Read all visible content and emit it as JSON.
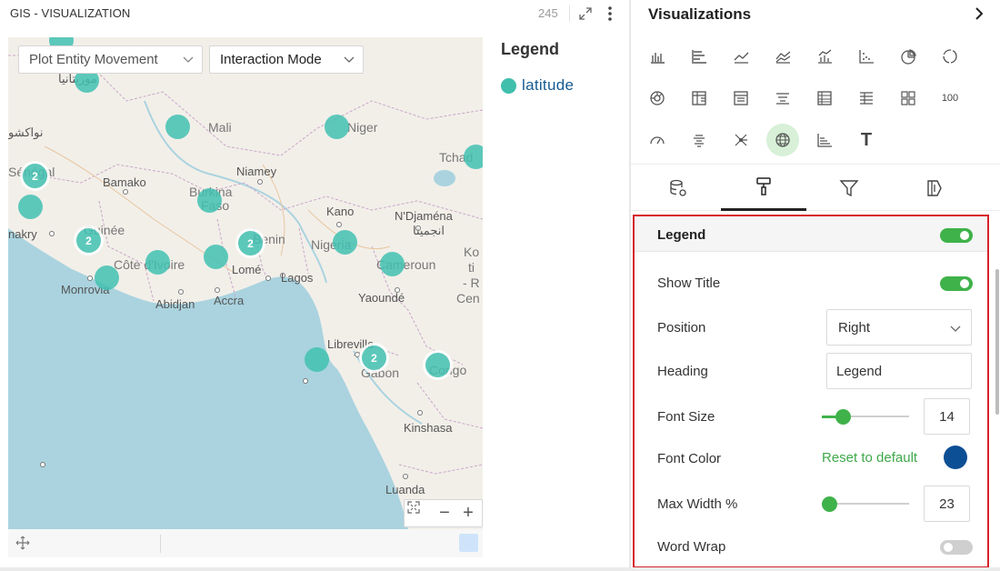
{
  "left_panel": {
    "title": "GIS - VISUALIZATION",
    "count": "245"
  },
  "map": {
    "dropdowns": {
      "plot_entity_movement": "Plot Entity Movement",
      "interaction_mode": "Interaction Mode"
    },
    "labels": {
      "mauritania": "موريتانيا",
      "nouakchott": "نواكشو",
      "mali": "Mali",
      "niger": "Niger",
      "tchad": "Tchad",
      "senegal": "Sénégal",
      "bamako": "Bamako",
      "niamey": "Niamey",
      "burkina": "Burkina",
      "faso": "Faso",
      "kano": "Kano",
      "ndjamena": "N'Djaména",
      "ndjamena_ar": "انجمينا",
      "conakry": "nakry",
      "guinee": "Guinée",
      "benin": "Benin",
      "nigeria": "Nigeria",
      "ko": "Ko",
      "cote_divoire": "Côte d'Ivoire",
      "lome": "Lomé",
      "lagos": "Lagos",
      "cameroun": "Cameroun",
      "ti": "ti",
      "r": "- R",
      "monrovia": "Monrovia",
      "abidjan": "Abidjan",
      "accra": "Accra",
      "yaounde": "Yaoundé",
      "cen": "Cen",
      "libreville": "Libreville",
      "gabon": "Gabon",
      "congo": "Congo",
      "kinshasa": "Kinshasa",
      "luanda": "Luanda"
    },
    "clusters": [
      {
        "label": ""
      },
      {
        "label": ""
      },
      {
        "label": ""
      },
      {
        "label": ""
      },
      {
        "label": ""
      },
      {
        "label": "2"
      },
      {
        "label": ""
      },
      {
        "label": ""
      },
      {
        "label": "2"
      },
      {
        "label": ""
      },
      {
        "label": ""
      },
      {
        "label": ""
      },
      {
        "label": "2"
      },
      {
        "label": ""
      },
      {
        "label": ""
      },
      {
        "label": ""
      },
      {
        "label": "2"
      },
      {
        "label": ""
      }
    ],
    "controls": {
      "zoom_out": "−",
      "zoom_in": "+"
    }
  },
  "legend": {
    "title": "Legend",
    "items": [
      {
        "label": "latitude",
        "color": "#3fbfac"
      }
    ]
  },
  "right_panel": {
    "title": "Visualizations",
    "viz_icons": [
      "column-chart-icon",
      "bar-chart-icon",
      "line-chart-icon",
      "area-chart-icon",
      "combo-chart-icon",
      "scatter-chart-icon",
      "pie-chart-icon",
      "donut-chart-icon",
      "sunburst-chart-icon",
      "pivot-table-icon",
      "card-list-icon",
      "funnel-icon",
      "table-icon",
      "kpi-table-icon",
      "matrix-icon",
      "number-card-icon",
      "gauge-icon",
      "word-cloud-icon",
      "network-graph-icon",
      "globe-map-icon",
      "step-chart-icon",
      "text-icon"
    ],
    "viz_number_label": "100",
    "viz_text_label": "T",
    "selected_viz": "globe-map-icon",
    "tabs": [
      "data-tab",
      "format-tab",
      "filter-tab",
      "analytics-tab"
    ],
    "active_tab": "format-tab",
    "legend_section": {
      "title": "Legend",
      "enabled": true,
      "show_title_label": "Show Title",
      "show_title": true,
      "position_label": "Position",
      "position_value": "Right",
      "heading_label": "Heading",
      "heading_value": "Legend",
      "font_size_label": "Font Size",
      "font_size_value": "14",
      "font_color_label": "Font Color",
      "reset_label": "Reset to default",
      "font_color": "#0d4f94",
      "max_width_label": "Max Width %",
      "max_width_value": "23",
      "word_wrap_label": "Word Wrap",
      "word_wrap": false
    }
  },
  "colors": {
    "accent_green": "#3fb24a",
    "cluster_teal": "#42c1b2",
    "highlight_red": "#d6232a",
    "map_water": "#aad3df",
    "map_land": "#f2efe9"
  }
}
